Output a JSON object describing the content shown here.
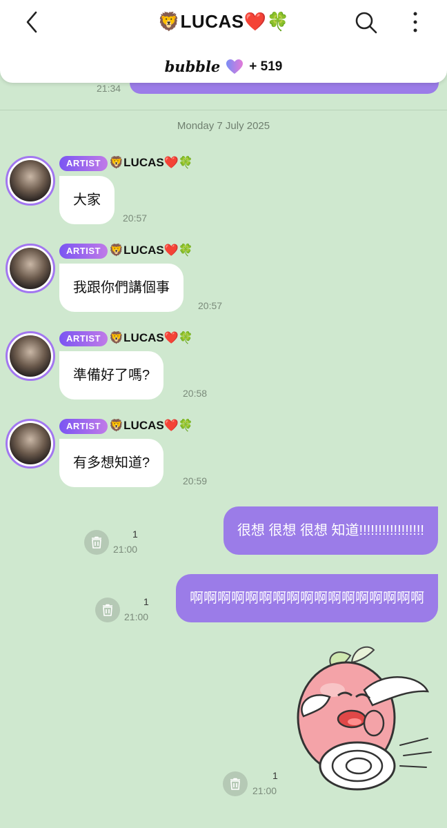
{
  "header": {
    "title": "🦁LUCAS❤️🍀",
    "bubble_logo": "bubble",
    "bubble_count": "+ 519"
  },
  "previous": {
    "time": "21:34"
  },
  "date_separator": "Monday 7 July 2025",
  "incoming": [
    {
      "badge": "ARTIST",
      "sender": "🦁LUCAS❤️🍀",
      "text": "大家",
      "time": "20:57"
    },
    {
      "badge": "ARTIST",
      "sender": "🦁LUCAS❤️🍀",
      "text": "我跟你們講個事",
      "time": "20:57"
    },
    {
      "badge": "ARTIST",
      "sender": "🦁LUCAS❤️🍀",
      "text": "準備好了嗎?",
      "time": "20:58"
    },
    {
      "badge": "ARTIST",
      "sender": "🦁LUCAS❤️🍀",
      "text": "有多想知道?",
      "time": "20:59"
    }
  ],
  "outgoing": [
    {
      "text": "很想 很想 很想 知道!!!!!!!!!!!!!!!!!",
      "read": "1",
      "time": "21:00"
    },
    {
      "text": "啊啊啊啊啊啊啊啊啊啊啊啊啊啊啊啊啊",
      "read": "1",
      "time": "21:00"
    },
    {
      "sticker": true,
      "read": "1",
      "time": "21:00"
    }
  ],
  "colors": {
    "background": "#cfe8cf",
    "out_bubble": "#9b7ce8",
    "artist_badge": "#7a55f2"
  }
}
